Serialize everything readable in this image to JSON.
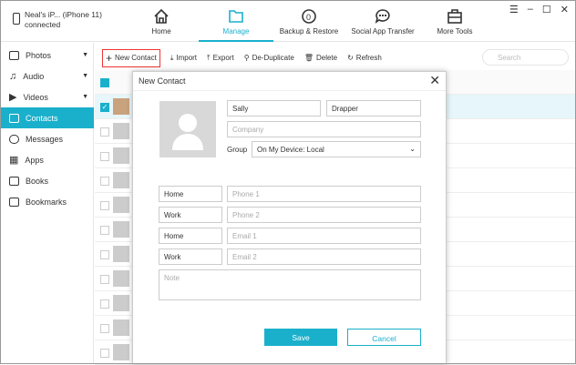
{
  "device": {
    "name": "Neal's iP... (iPhone 11)",
    "status": "connected"
  },
  "nav": [
    {
      "label": "Home",
      "icon": "home-icon"
    },
    {
      "label": "Manage",
      "icon": "folder-icon"
    },
    {
      "label": "Backup & Restore",
      "icon": "backup-icon"
    },
    {
      "label": "Social App Transfer",
      "icon": "chat-icon"
    },
    {
      "label": "More Tools",
      "icon": "toolbox-icon"
    }
  ],
  "sidebar": [
    {
      "label": "Photos"
    },
    {
      "label": "Audio"
    },
    {
      "label": "Videos"
    },
    {
      "label": "Contacts"
    },
    {
      "label": "Messages"
    },
    {
      "label": "Apps"
    },
    {
      "label": "Books"
    },
    {
      "label": "Bookmarks"
    }
  ],
  "toolbar": {
    "new_contact": "New Contact",
    "import": "Import",
    "export": "Export",
    "dedupe": "De-Duplicate",
    "delete": "Delete",
    "refresh": "Refresh",
    "search_placeholder": "Search"
  },
  "dialog": {
    "title": "New Contact",
    "first_name": "Sally",
    "last_name": "Drapper",
    "company_placeholder": "Company",
    "group_label": "Group",
    "group_value": "On My Device: Local",
    "phone1_type": "Home",
    "phone1_placeholder": "Phone 1",
    "phone2_type": "Work",
    "phone2_placeholder": "Phone 2",
    "email1_type": "Home",
    "email1_placeholder": "Email 1",
    "email2_type": "Work",
    "email2_placeholder": "Email 2",
    "note_placeholder": "Note",
    "save": "Save",
    "cancel": "Cancel"
  },
  "colors": {
    "accent": "#1ab0cc"
  }
}
